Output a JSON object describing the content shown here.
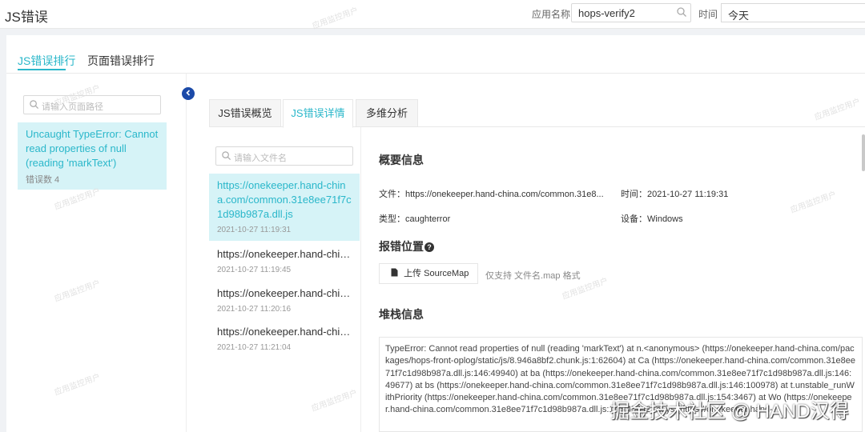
{
  "header": {
    "title": "JS错误",
    "app_label": "应用名称",
    "app_value": "hops-verify2",
    "time_label": "时间",
    "time_value": "今天"
  },
  "top_tabs": [
    {
      "label": "JS错误排行"
    },
    {
      "label": "页面错误排行"
    }
  ],
  "left_panel": {
    "search_placeholder": "请输入页面路径",
    "errors": [
      {
        "message": "Uncaught TypeError: Cannot read properties of null (reading 'markText')",
        "count_text": "错误数 4"
      }
    ]
  },
  "detail_tabs": [
    {
      "label": "JS错误概览"
    },
    {
      "label": "JS错误详情"
    },
    {
      "label": "多维分析"
    }
  ],
  "file_list": {
    "search_placeholder": "请输入文件名",
    "items": [
      {
        "name": "https://onekeeper.hand-china.com/common.31e8ee71f7c1d98b987a.dll.js",
        "time": "2021-10-27 11:19:31"
      },
      {
        "name": "https://onekeeper.hand-china.com/common.31e8ee71f7c1d98b987a.dll.js",
        "time": "2021-10-27 11:19:45"
      },
      {
        "name": "https://onekeeper.hand-china.com/common.31e8ee71f7c1d98b987a.dll.js",
        "time": "2021-10-27 11:20:16"
      },
      {
        "name": "https://onekeeper.hand-china.com/common.31e8ee71f7c1d98b987a.dll.js",
        "time": "2021-10-27 11:21:04"
      }
    ]
  },
  "overview": {
    "title": "概要信息",
    "file_text": "文件：https://onekeeper.hand-china.com/common.31e8...",
    "time_text": "时间：2021-10-27 11:19:31",
    "type_text": "类型：caughterror",
    "device_text": "设备：Windows"
  },
  "location": {
    "title": "报错位置",
    "help_glyph": "?",
    "upload_label": "上传 SourceMap",
    "hint": "仅支持 文件名.map 格式"
  },
  "stack": {
    "title": "堆栈信息",
    "text": "TypeError: Cannot read properties of null (reading 'markText') at n.<anonymous> (https://onekeeper.hand-china.com/packages/hops-front-oplog/static/js/8.946a8bf2.chunk.js:1:62604) at Ca (https://onekeeper.hand-china.com/common.31e8ee71f7c1d98b987a.dll.js:146:49940) at ba (https://onekeeper.hand-china.com/common.31e8ee71f7c1d98b987a.dll.js:146:49677) at bs (https://onekeeper.hand-china.com/common.31e8ee71f7c1d98b987a.dll.js:146:100978) at t.unstable_runWithPriority (https://onekeeper.hand-china.com/common.31e8ee71f7c1d98b987a.dll.js:154:3467) at Wo (https://onekeeper.hand-china.com/common.31e8ee71f7c1d98b987a.dll.js:146:45442) at ys (https://onekeeper.hand-"
  },
  "watermark": {
    "text": "应用监控用户",
    "footer": "掘金技术社区 @ HAND汉得"
  },
  "colors": {
    "accent": "#2ab7ca",
    "selected_bg": "#d6f3f7",
    "collapse_button": "#1b4aa8"
  },
  "icons": [
    "search-icon",
    "upload-file-icon",
    "help-icon",
    "chevron-left-icon"
  ]
}
